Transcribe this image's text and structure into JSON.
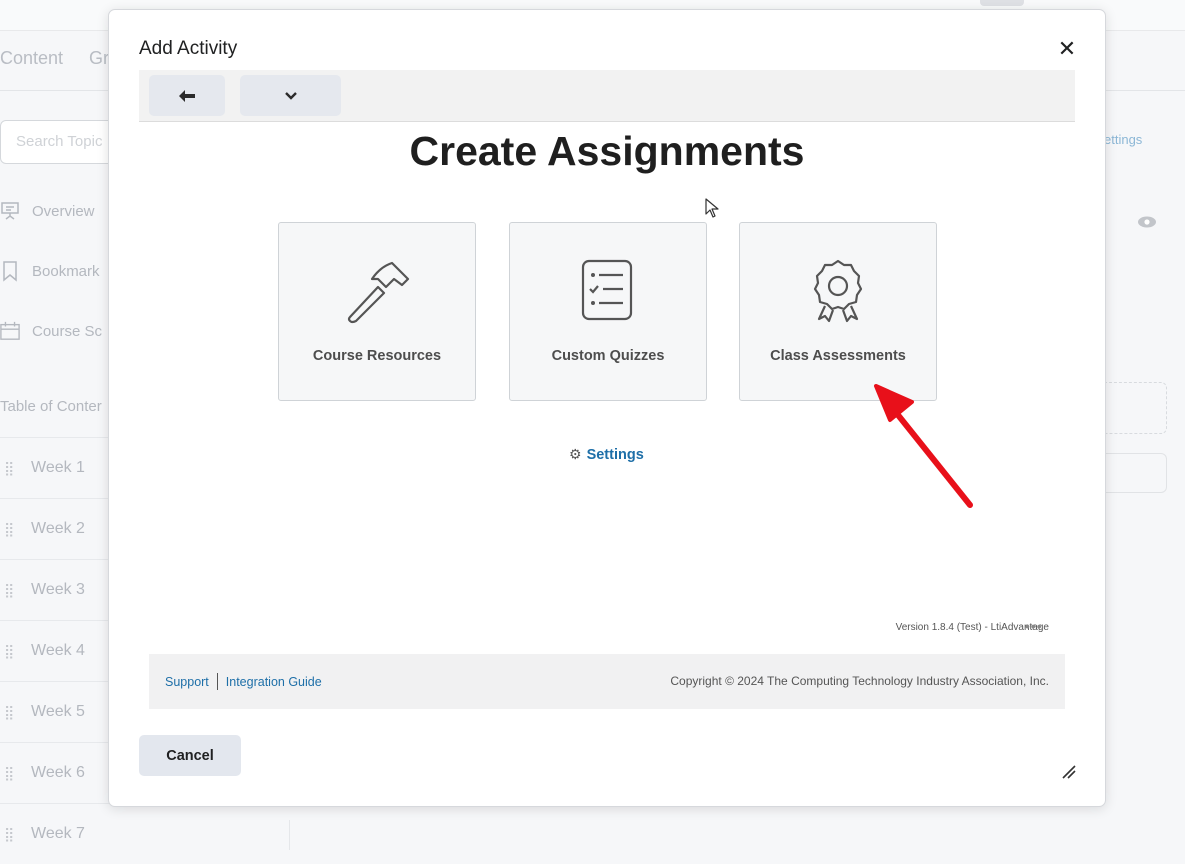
{
  "background": {
    "nav": [
      "Content",
      "Gr"
    ],
    "search_placeholder": "Search Topic",
    "sidebar": [
      "Overview",
      "Bookmark",
      "Course Sc"
    ],
    "toc_label": "Table of Conter",
    "weeks": [
      "Week 1",
      "Week 2",
      "Week 3",
      "Week 4",
      "Week 5",
      "Week 6",
      "Week 7"
    ],
    "settings_fragment": "ettings"
  },
  "dialog": {
    "title": "Add Activity",
    "close_glyph": "✕",
    "toolbar": {
      "back_glyph": "🡄",
      "dropdown_glyph": "⌄"
    },
    "heading": "Create Assignments",
    "cards": [
      {
        "label": "Course Resources",
        "icon": "hammer-icon"
      },
      {
        "label": "Custom Quizzes",
        "icon": "checklist-icon"
      },
      {
        "label": "Class Assessments",
        "icon": "award-badge-icon"
      }
    ],
    "settings_label": "Settings",
    "version": "Version 1.8.4 (Test) - LtiAdvantage",
    "more_glyph": "•••",
    "footer": {
      "support": "Support",
      "integration_guide": "Integration Guide",
      "copyright": "Copyright © 2024 The Computing Technology Industry Association, Inc."
    },
    "cancel_label": "Cancel"
  },
  "colors": {
    "link": "#1e6fa8",
    "annotation_arrow": "#e8101a",
    "button_bg": "#e3e7ee"
  }
}
